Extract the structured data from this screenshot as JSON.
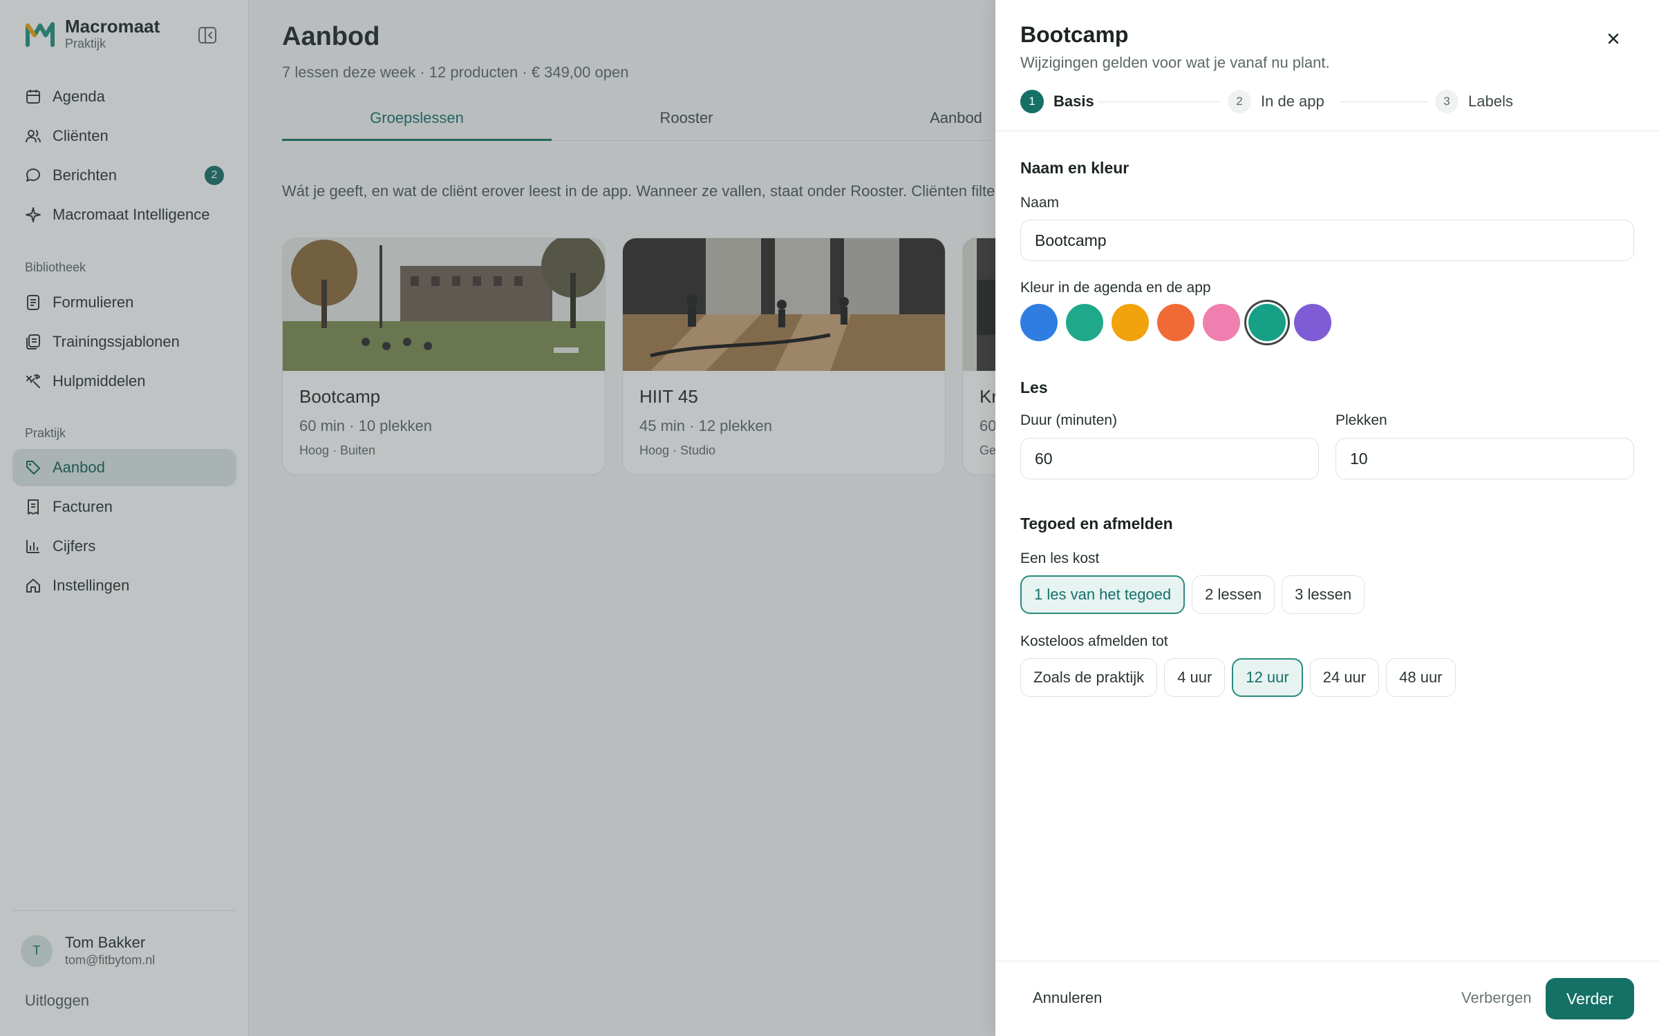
{
  "brand": {
    "name": "Macromaat",
    "subtitle": "Praktijk"
  },
  "sidebar": {
    "items": [
      {
        "label": "Agenda",
        "icon": "calendar-icon"
      },
      {
        "label": "Cliënten",
        "icon": "users-icon"
      },
      {
        "label": "Berichten",
        "icon": "chat-icon",
        "badge": "2"
      },
      {
        "label": "Macromaat Intelligence",
        "icon": "sparkle-icon"
      }
    ],
    "section_library": "Bibliotheek",
    "library_items": [
      {
        "label": "Formulieren",
        "icon": "form-icon"
      },
      {
        "label": "Trainingssjablonen",
        "icon": "template-icon"
      },
      {
        "label": "Hulpmiddelen",
        "icon": "tools-icon"
      }
    ],
    "section_practice": "Praktijk",
    "practice_items": [
      {
        "label": "Aanbod",
        "icon": "tag-icon",
        "active": true
      },
      {
        "label": "Facturen",
        "icon": "invoice-icon"
      },
      {
        "label": "Cijfers",
        "icon": "chart-icon"
      },
      {
        "label": "Instellingen",
        "icon": "home-icon"
      }
    ],
    "user": {
      "initial": "T",
      "name": "Tom Bakker",
      "email": "tom@fitbytom.nl"
    },
    "logout": "Uitloggen"
  },
  "main": {
    "title": "Aanbod",
    "subtitle": "7 lessen deze week · 12 producten · € 349,00 open",
    "tabs": [
      {
        "label": "Groepslessen",
        "active": true
      },
      {
        "label": "Rooster"
      },
      {
        "label": "Aanbod"
      }
    ],
    "intro": "Wát je geeft, en wat de cliënt erover leest in de app. Wanneer ze vallen, staat onder Rooster. Cliënten filteren",
    "cards": [
      {
        "title": "Bootcamp",
        "meta": "60 min · 10 plekken",
        "tags": "Hoog · Buiten"
      },
      {
        "title": "HIIT 45",
        "meta": "45 min · 12 plekken",
        "tags": "Hoog · Studio"
      },
      {
        "title": "Kr",
        "meta": "60",
        "tags": "Ge"
      }
    ]
  },
  "drawer": {
    "title": "Bootcamp",
    "subtitle": "Wijzigingen gelden voor wat je vanaf nu plant.",
    "steps": [
      {
        "num": "1",
        "label": "Basis",
        "active": true
      },
      {
        "num": "2",
        "label": "In de app"
      },
      {
        "num": "3",
        "label": "Labels"
      }
    ],
    "section_name": "Naam en kleur",
    "name_label": "Naam",
    "name_value": "Bootcamp",
    "color_label": "Kleur in de agenda en de app",
    "colors": [
      "#2f7de1",
      "#1fa88a",
      "#f0a30a",
      "#f06a35",
      "#ee7fae",
      "#16a085",
      "#7e5cd6"
    ],
    "selected_color_index": 5,
    "section_lesson": "Les",
    "duration_label": "Duur (minuten)",
    "duration_value": "60",
    "spots_label": "Plekken",
    "spots_value": "10",
    "section_credit": "Tegoed en afmelden",
    "cost_label": "Een les kost",
    "cost_options": [
      "1 les van het tegoed",
      "2 lessen",
      "3 lessen"
    ],
    "cost_selected": 0,
    "cancel_label": "Kosteloos afmelden tot",
    "cancel_options": [
      "Zoals de praktijk",
      "4 uur",
      "12 uur",
      "24 uur",
      "48 uur"
    ],
    "cancel_selected": 2,
    "footer": {
      "cancel": "Annuleren",
      "hide": "Verbergen",
      "next": "Verder"
    }
  },
  "colors": {
    "accent": "#157066",
    "accent_soft": "#e7f3f1",
    "nav_active_bg": "#dbe7e6"
  }
}
